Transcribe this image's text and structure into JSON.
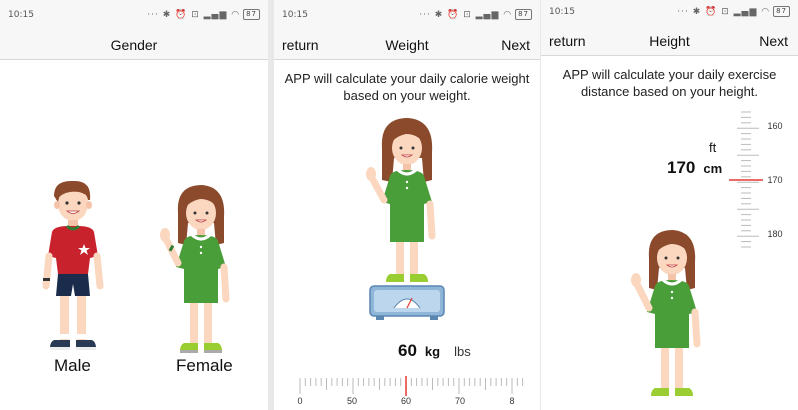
{
  "status": {
    "time": "10:15",
    "icons": "··· ✱ ⏰ ⊡ ▂▄▆ ◠",
    "battery": "87"
  },
  "gender_screen": {
    "title": "Gender",
    "male_label": "Male",
    "female_label": "Female"
  },
  "weight_screen": {
    "return_label": "return",
    "title": "Weight",
    "next_label": "Next",
    "description": "APP will calculate your daily calorie weight based on your weight.",
    "value": "60",
    "unit_selected": "kg",
    "unit_other": "lbs",
    "ruler_labels": [
      "0",
      "50",
      "60",
      "70",
      "8"
    ],
    "ruler_value": 60
  },
  "height_screen": {
    "return_label": "return",
    "title": "Height",
    "next_label": "Next",
    "description": "APP will calculate your daily exercise distance based on your height.",
    "unit_other": "ft",
    "value": "170",
    "unit_selected": "cm",
    "ruler_labels": [
      "160",
      "170",
      "180"
    ],
    "ruler_value": 170
  },
  "colors": {
    "accent_red": "#e53935",
    "dress_green": "#4a9e3a",
    "shirt_red": "#c8232c",
    "hair_brown": "#8b4a2b"
  }
}
